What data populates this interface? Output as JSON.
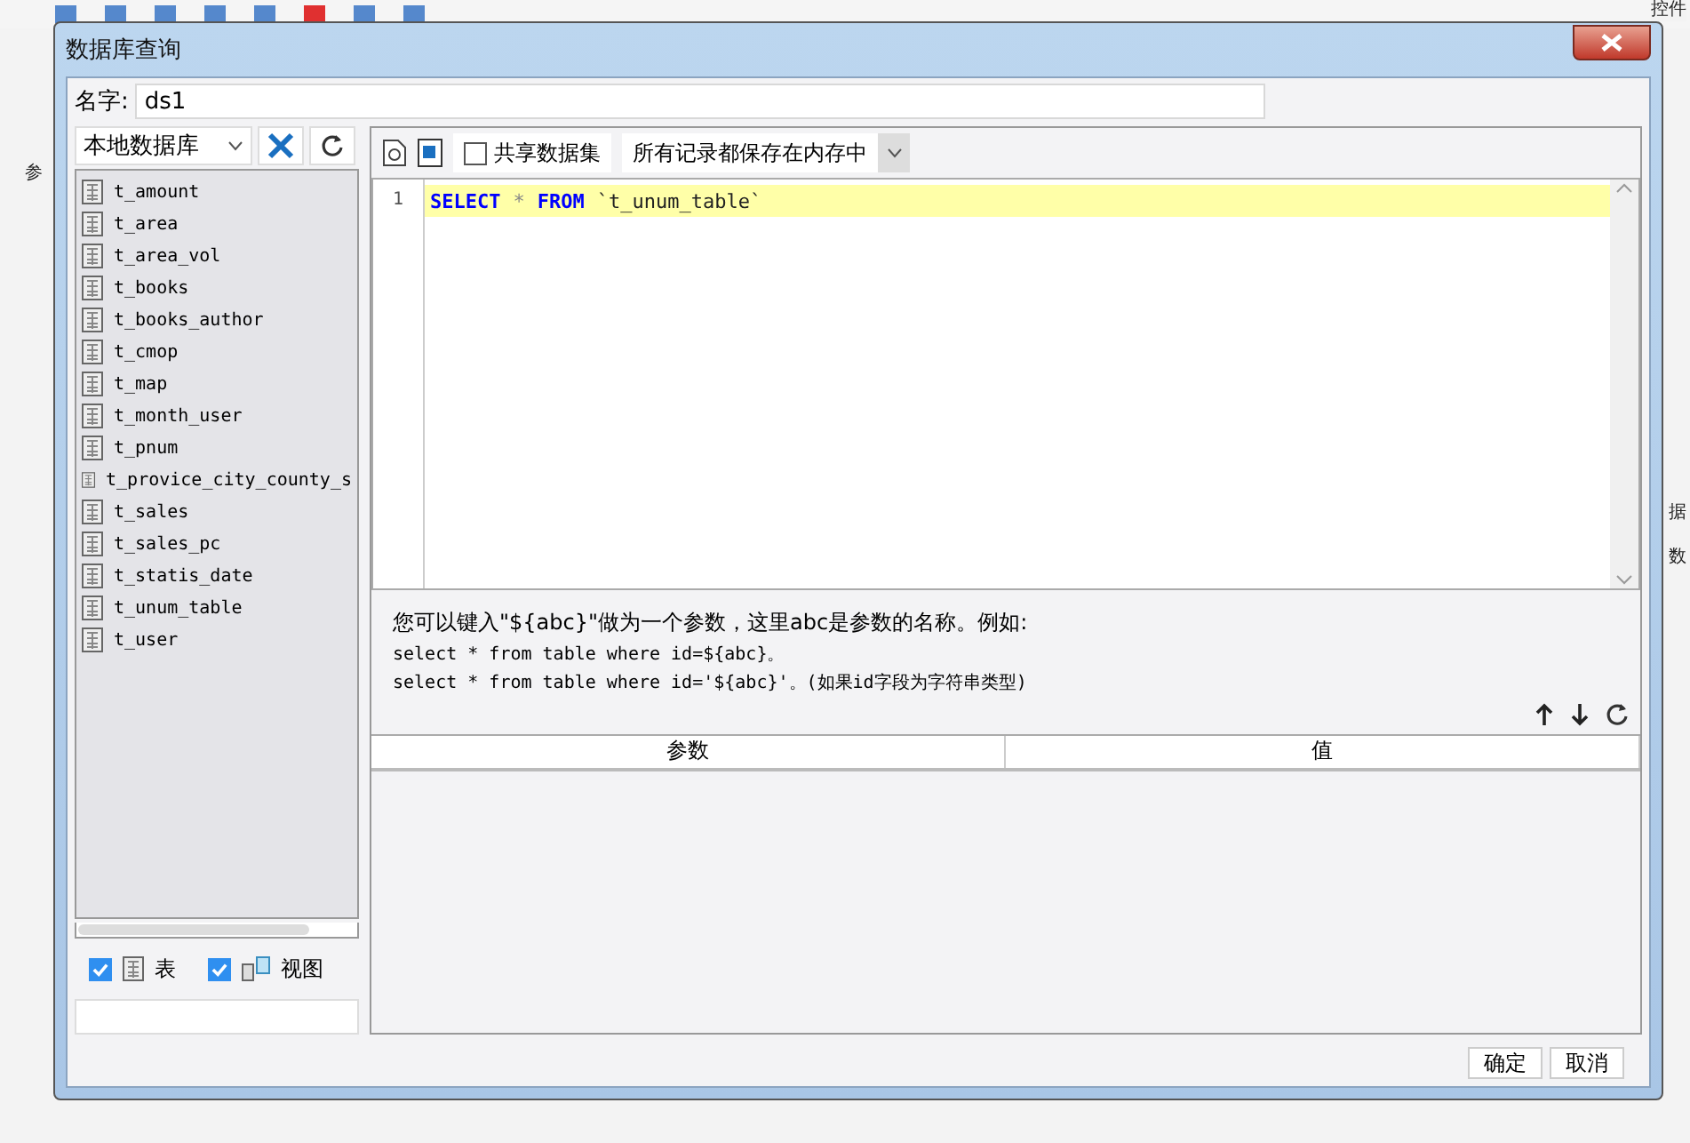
{
  "background": {
    "texts": [
      "控件",
      "参",
      "据",
      "数"
    ]
  },
  "window": {
    "title": "数据库查询"
  },
  "name_field": {
    "label": "名字:",
    "value": "ds1"
  },
  "sidebar": {
    "database": "本地数据库",
    "items": [
      {
        "label": "t_amount"
      },
      {
        "label": "t_area"
      },
      {
        "label": "t_area_vol"
      },
      {
        "label": "t_books"
      },
      {
        "label": "t_books_author"
      },
      {
        "label": "t_cmop"
      },
      {
        "label": "t_map"
      },
      {
        "label": "t_month_user"
      },
      {
        "label": "t_pnum"
      },
      {
        "label": "t_provice_city_county_s"
      },
      {
        "label": "t_sales"
      },
      {
        "label": "t_sales_pc"
      },
      {
        "label": "t_statis_date"
      },
      {
        "label": "t_unum_table"
      },
      {
        "label": "t_user"
      }
    ],
    "filters": [
      {
        "kind": "table",
        "label": "表",
        "checked": true
      },
      {
        "kind": "view",
        "label": "视图",
        "checked": true
      }
    ]
  },
  "toolbar": {
    "share": {
      "label": "共享数据集",
      "checked": false
    },
    "storage": "所有记录都保存在内存中"
  },
  "editor": {
    "lines": [
      {
        "number": "1",
        "tokens": [
          {
            "kind": "keyword",
            "text": "SELECT"
          },
          {
            "kind": "op",
            "text": "*"
          },
          {
            "kind": "keyword",
            "text": "FROM"
          },
          {
            "kind": "ident",
            "text": "`t_unum_table`"
          }
        ]
      }
    ]
  },
  "hint": [
    "您可以键入\"${abc}\"做为一个参数，这里abc是参数的名称。例如:",
    "select * from table where id=${abc}。",
    "select * from table where id='${abc}'。(如果id字段为字符串类型)"
  ],
  "params_table": {
    "columns": [
      "参数",
      "值"
    ]
  },
  "buttons": [
    "确定",
    "取消"
  ]
}
